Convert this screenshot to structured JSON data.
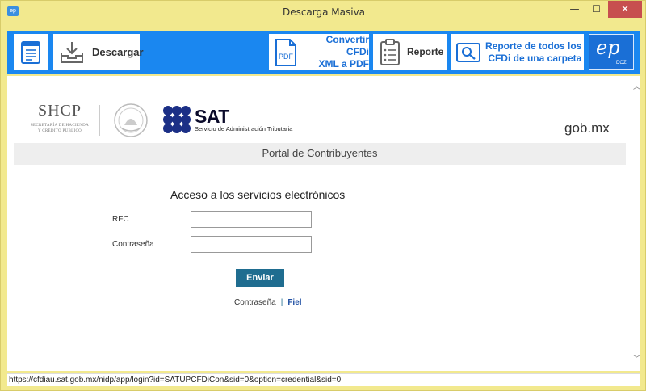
{
  "window": {
    "title": "Descarga Masiva",
    "minimize": "—",
    "maximize": "☐",
    "close": "✕"
  },
  "toolbar": {
    "descargar_label": "Descargar",
    "convertir_line1": "Convertir CFDi",
    "convertir_line2": "XML a PDF",
    "reporte_label": "Reporte",
    "reporte_todos_line1": "Reporte de todos los",
    "reporte_todos_line2": "CFDi de una carpeta",
    "logo_text": "ep",
    "logo_sub": "DOZ",
    "pdf_icon_text": "PDF",
    "accent": "#1a87f0"
  },
  "page": {
    "shcp_title": "SHCP",
    "shcp_sub1": "SECRETARÍA DE HACIENDA",
    "shcp_sub2": "Y CRÉDITO PÚBLICO",
    "sat_word": "SAT",
    "sat_sub": "Servicio de Administración Tributaria",
    "gobmx": "gob.mx",
    "portal_title": "Portal de Contribuyentes",
    "access_title": "Acceso a los servicios electrónicos",
    "rfc_label": "RFC",
    "rfc_value": "",
    "pass_label": "Contraseña",
    "pass_value": "",
    "submit_label": "Enviar",
    "link_contrasena": "Contraseña",
    "link_sep": "|",
    "link_fiel": "Fiel"
  },
  "status": {
    "url": "https://cfdiau.sat.gob.mx/nidp/app/login?id=SATUPCFDiCon&sid=0&option=credential&sid=0"
  }
}
